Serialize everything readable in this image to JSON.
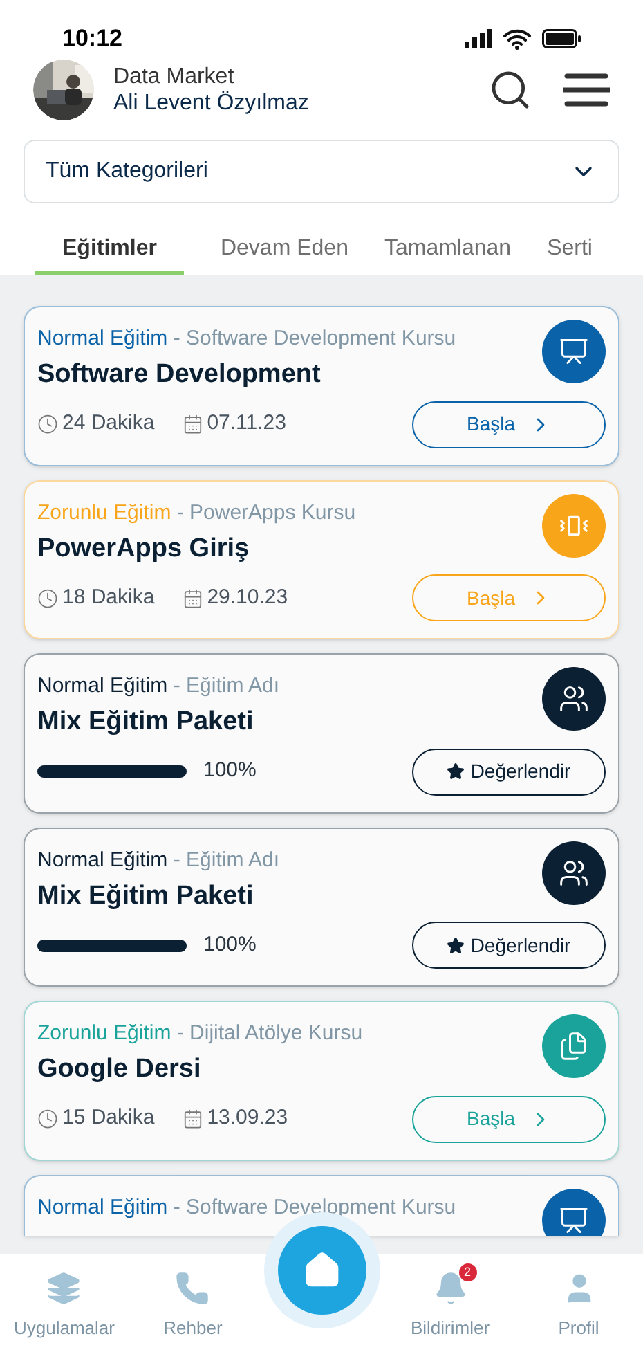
{
  "status_bar": {
    "time": "10:12"
  },
  "header": {
    "company": "Data Market",
    "user": "Ali Levent Özyılmaz"
  },
  "category_select": {
    "value": "Tüm Kategorileri"
  },
  "tabs": [
    {
      "label": "Eğitimler",
      "selected": true
    },
    {
      "label": "Devam Eden",
      "selected": false
    },
    {
      "label": "Tamamlanan",
      "selected": false
    },
    {
      "label": "Serti",
      "selected": false
    }
  ],
  "courses": [
    {
      "kind": "start",
      "type": "Normal Eğitim",
      "course": "- Software Development Kursu",
      "title": "Software Development",
      "color": "#0a62a8",
      "duration": "24 Dakika",
      "date": "07.11.23",
      "action": "Başla"
    },
    {
      "kind": "start",
      "type": "Zorunlu Eğitim",
      "course": "- PowerApps Kursu",
      "title": "PowerApps Giriş",
      "color": "#f9a51a",
      "duration": "18 Dakika",
      "date": "29.10.23",
      "action": "Başla"
    },
    {
      "kind": "rate",
      "type": "Normal Eğitim",
      "course": "- Eğitim Adı",
      "title": "Mix Eğitim Paketi",
      "color": "#0b2033",
      "level": 1,
      "progress": "100%",
      "action": "Değerlendir"
    },
    {
      "kind": "rate",
      "type": "Normal Eğitim",
      "course": "- Eğitim Adı",
      "title": "Mix Eğitim Paketi",
      "color": "#0b2033",
      "level": 1,
      "progress": "100%",
      "action": "Değerlendir"
    },
    {
      "kind": "start",
      "type": "Zorunlu Eğitim",
      "course": "- Dijital Atölye Kursu",
      "title": "Google Dersi",
      "color": "#1aa39a",
      "duration": "15 Dakika",
      "date": "13.09.23",
      "action": "Başla"
    },
    {
      "kind": "peek",
      "type": "Normal Eğitim",
      "course": "- Software Development Kursu",
      "color": "#0a62a8"
    }
  ],
  "bottom_nav": [
    {
      "kind": "apps",
      "label": "Uygulamalar"
    },
    {
      "kind": "contacts",
      "label": "Rehber"
    },
    {
      "kind": "home"
    },
    {
      "kind": "notifications",
      "label": "Bildirimler",
      "badge": "2"
    },
    {
      "kind": "profile",
      "label": "Profil"
    }
  ]
}
